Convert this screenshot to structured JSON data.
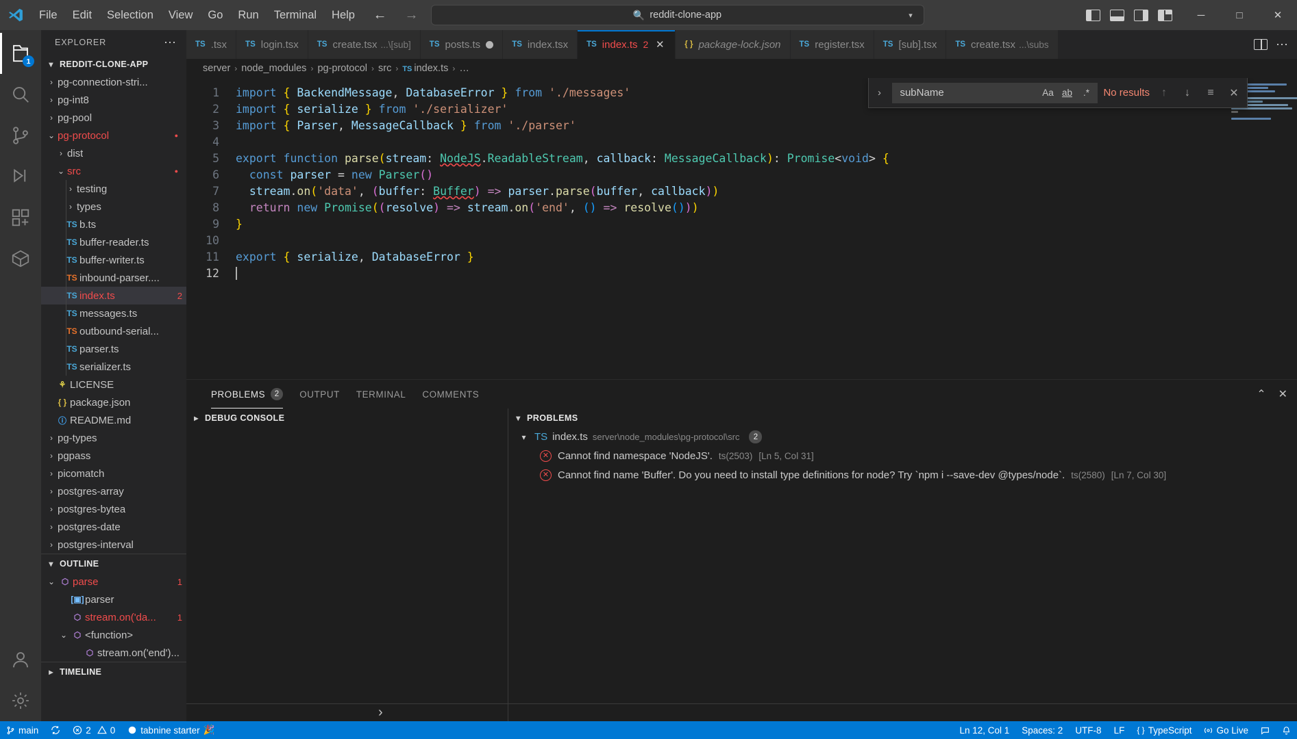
{
  "titlebar": {
    "menus": [
      "File",
      "Edit",
      "Selection",
      "View",
      "Go",
      "Run",
      "Terminal",
      "Help"
    ],
    "command_center_text": "reddit-clone-app",
    "search_icon": "search-icon",
    "back_icon": "arrow-left-icon",
    "forward_icon": "arrow-right-icon",
    "chevron": "⌄",
    "window_minimize": "─",
    "window_maximize": "□",
    "window_close": "✕"
  },
  "activitybar": {
    "items": [
      {
        "name": "explorer",
        "icon": "files-icon",
        "active": true,
        "badge": "1"
      },
      {
        "name": "search",
        "icon": "search-icon",
        "active": false,
        "badge": ""
      },
      {
        "name": "source-control",
        "icon": "source-control-icon",
        "active": false,
        "badge": ""
      },
      {
        "name": "run-and-debug",
        "icon": "debug-icon",
        "active": false,
        "badge": ""
      },
      {
        "name": "extensions",
        "icon": "extensions-icon",
        "active": false,
        "badge": ""
      },
      {
        "name": "remote-explorer",
        "icon": "remote-explorer-icon",
        "active": false,
        "badge": ""
      }
    ],
    "bottom": [
      {
        "name": "accounts",
        "icon": "account-icon"
      },
      {
        "name": "manage",
        "icon": "gear-icon"
      }
    ]
  },
  "sidebar": {
    "title": "EXPLORER",
    "more_actions": "⋯",
    "project": "REDDIT-CLONE-APP",
    "files": [
      {
        "label": "pg-connection-stri...",
        "type": "folder",
        "indent": 1,
        "expanded": false,
        "color": "",
        "count": ""
      },
      {
        "label": "pg-int8",
        "type": "folder",
        "indent": 1,
        "expanded": false,
        "color": "",
        "count": ""
      },
      {
        "label": "pg-pool",
        "type": "folder",
        "indent": 1,
        "expanded": false,
        "color": "",
        "count": ""
      },
      {
        "label": "pg-protocol",
        "type": "folder",
        "indent": 1,
        "expanded": true,
        "color": "error",
        "count": "dot"
      },
      {
        "label": "dist",
        "type": "folder",
        "indent": 2,
        "expanded": false,
        "color": "",
        "count": ""
      },
      {
        "label": "src",
        "type": "folder",
        "indent": 2,
        "expanded": true,
        "color": "error",
        "count": "dot"
      },
      {
        "label": "testing",
        "type": "folder",
        "indent": 3,
        "expanded": false,
        "color": "",
        "count": ""
      },
      {
        "label": "types",
        "type": "folder",
        "indent": 3,
        "expanded": false,
        "color": "",
        "count": ""
      },
      {
        "label": "b.ts",
        "type": "ts",
        "indent": 3,
        "expanded": false,
        "color": "",
        "count": ""
      },
      {
        "label": "buffer-reader.ts",
        "type": "ts",
        "indent": 3,
        "expanded": false,
        "color": "",
        "count": ""
      },
      {
        "label": "buffer-writer.ts",
        "type": "ts",
        "indent": 3,
        "expanded": false,
        "color": "",
        "count": ""
      },
      {
        "label": "inbound-parser....",
        "type": "ts-orange",
        "indent": 3,
        "expanded": false,
        "color": "",
        "count": ""
      },
      {
        "label": "index.ts",
        "type": "ts",
        "indent": 3,
        "expanded": false,
        "color": "error",
        "count": "2",
        "selected": true
      },
      {
        "label": "messages.ts",
        "type": "ts",
        "indent": 3,
        "expanded": false,
        "color": "",
        "count": ""
      },
      {
        "label": "outbound-serial...",
        "type": "ts-orange",
        "indent": 3,
        "expanded": false,
        "color": "",
        "count": ""
      },
      {
        "label": "parser.ts",
        "type": "ts",
        "indent": 3,
        "expanded": false,
        "color": "",
        "count": ""
      },
      {
        "label": "serializer.ts",
        "type": "ts",
        "indent": 3,
        "expanded": false,
        "color": "",
        "count": ""
      },
      {
        "label": "LICENSE",
        "type": "license",
        "indent": 2,
        "expanded": false,
        "color": "",
        "count": ""
      },
      {
        "label": "package.json",
        "type": "json",
        "indent": 2,
        "expanded": false,
        "color": "",
        "count": ""
      },
      {
        "label": "README.md",
        "type": "md",
        "indent": 2,
        "expanded": false,
        "color": "",
        "count": ""
      },
      {
        "label": "pg-types",
        "type": "folder",
        "indent": 1,
        "expanded": false,
        "color": "",
        "count": ""
      },
      {
        "label": "pgpass",
        "type": "folder",
        "indent": 1,
        "expanded": false,
        "color": "",
        "count": ""
      },
      {
        "label": "picomatch",
        "type": "folder",
        "indent": 1,
        "expanded": false,
        "color": "",
        "count": ""
      },
      {
        "label": "postgres-array",
        "type": "folder",
        "indent": 1,
        "expanded": false,
        "color": "",
        "count": ""
      },
      {
        "label": "postgres-bytea",
        "type": "folder",
        "indent": 1,
        "expanded": false,
        "color": "",
        "count": ""
      },
      {
        "label": "postgres-date",
        "type": "folder",
        "indent": 1,
        "expanded": false,
        "color": "",
        "count": ""
      },
      {
        "label": "postgres-interval",
        "type": "folder",
        "indent": 1,
        "expanded": false,
        "color": "",
        "count": ""
      }
    ],
    "outline": {
      "title": "OUTLINE",
      "items": [
        {
          "label": "parse",
          "symbol": "function",
          "indent": 1,
          "expanded": true,
          "count": "1",
          "error": true
        },
        {
          "label": "parser",
          "symbol": "variable",
          "indent": 2,
          "expanded": null,
          "count": "",
          "error": false
        },
        {
          "label": "stream.on('da...",
          "symbol": "function",
          "indent": 2,
          "expanded": null,
          "count": "1",
          "error": true
        },
        {
          "label": "<function>",
          "symbol": "function",
          "indent": 2,
          "expanded": true,
          "count": "",
          "error": false
        },
        {
          "label": "stream.on('end')...",
          "symbol": "function",
          "indent": 3,
          "expanded": null,
          "count": "",
          "error": false
        }
      ]
    },
    "timeline": {
      "title": "TIMELINE"
    }
  },
  "tabs": [
    {
      "label": ".tsx",
      "icon": "ts",
      "sub": "",
      "active": false,
      "modified": false,
      "errors": "",
      "preview": false,
      "partial": true
    },
    {
      "label": "login.tsx",
      "icon": "ts",
      "sub": "",
      "active": false,
      "modified": false,
      "errors": "",
      "preview": false
    },
    {
      "label": "create.tsx",
      "icon": "ts",
      "sub": "...\\[sub]",
      "active": false,
      "modified": false,
      "errors": "",
      "preview": false
    },
    {
      "label": "posts.ts",
      "icon": "ts",
      "sub": "",
      "active": false,
      "modified": true,
      "errors": "",
      "preview": false
    },
    {
      "label": "index.tsx",
      "icon": "ts",
      "sub": "",
      "active": false,
      "modified": false,
      "errors": "",
      "preview": false
    },
    {
      "label": "index.ts",
      "icon": "ts",
      "sub": "",
      "active": true,
      "modified": false,
      "errors": "2",
      "preview": false
    },
    {
      "label": "package-lock.json",
      "icon": "json",
      "sub": "",
      "active": false,
      "modified": false,
      "errors": "",
      "preview": true
    },
    {
      "label": "register.tsx",
      "icon": "ts",
      "sub": "",
      "active": false,
      "modified": false,
      "errors": "",
      "preview": false
    },
    {
      "label": "[sub].tsx",
      "icon": "ts",
      "sub": "",
      "active": false,
      "modified": false,
      "errors": "",
      "preview": false
    },
    {
      "label": "create.tsx",
      "icon": "ts",
      "sub": "...\\subs",
      "active": false,
      "modified": false,
      "errors": "",
      "preview": false
    }
  ],
  "breadcrumbs": [
    {
      "label": "server",
      "icon": ""
    },
    {
      "label": "node_modules",
      "icon": ""
    },
    {
      "label": "pg-protocol",
      "icon": ""
    },
    {
      "label": "src",
      "icon": ""
    },
    {
      "label": "index.ts",
      "icon": "ts"
    },
    {
      "label": "…",
      "icon": ""
    }
  ],
  "find": {
    "query": "subName",
    "placeholder": "Find",
    "result": "No results",
    "match_case": "Aa",
    "whole_word": "ab",
    "regex": ".*",
    "prev": "↑",
    "next": "↓",
    "find_in_selection": "≡",
    "close": "✕",
    "toggle_replace": "›"
  },
  "editor": {
    "language": "TypeScript",
    "lines": [
      {
        "n": "1",
        "text": "import { BackendMessage, DatabaseError } from './messages'"
      },
      {
        "n": "2",
        "text": "import { serialize } from './serializer'"
      },
      {
        "n": "3",
        "text": "import { Parser, MessageCallback } from './parser'"
      },
      {
        "n": "4",
        "text": ""
      },
      {
        "n": "5",
        "text": "export function parse(stream: NodeJS.ReadableStream, callback: MessageCallback): Promise<void> {"
      },
      {
        "n": "6",
        "text": "  const parser = new Parser()"
      },
      {
        "n": "7",
        "text": "  stream.on('data', (buffer: Buffer) => parser.parse(buffer, callback))"
      },
      {
        "n": "8",
        "text": "  return new Promise((resolve) => stream.on('end', () => resolve()))"
      },
      {
        "n": "9",
        "text": "}"
      },
      {
        "n": "10",
        "text": ""
      },
      {
        "n": "11",
        "text": "export { serialize, DatabaseError }"
      },
      {
        "n": "12",
        "text": ""
      }
    ]
  },
  "panel": {
    "tabs": [
      {
        "label": "PROBLEMS",
        "badge": "2",
        "active": true
      },
      {
        "label": "OUTPUT",
        "badge": "",
        "active": false
      },
      {
        "label": "TERMINAL",
        "badge": "",
        "active": false
      },
      {
        "label": "COMMENTS",
        "badge": "",
        "active": false
      }
    ],
    "actions": {
      "collapse": "⌃",
      "close": "✕"
    },
    "debug_console": {
      "title": "DEBUG CONSOLE",
      "chevron": "›"
    },
    "problems": {
      "title": "PROBLEMS",
      "file": {
        "name": "index.ts",
        "path": "server\\node_modules\\pg-protocol\\src",
        "count": "2",
        "icon": "ts"
      },
      "items": [
        {
          "message": "Cannot find namespace 'NodeJS'.",
          "code": "ts(2503)",
          "location": "[Ln 5, Col 31]",
          "severity": "error"
        },
        {
          "message": "Cannot find name 'Buffer'. Do you need to install type definitions for node? Try `npm i --save-dev @types/node`.",
          "code": "ts(2580)",
          "location": "[Ln 7, Col 30]",
          "severity": "error"
        }
      ]
    }
  },
  "statusbar": {
    "branch": "main",
    "branch_icon": "source-control-icon",
    "sync_icon": "sync-icon",
    "errors": "2",
    "warnings": "0",
    "error_icon": "error-icon",
    "warning_icon": "warning-icon",
    "tabnine": "tabnine starter",
    "tabnine_icon": "tabnine-icon",
    "tabnine_emoji": "🎉",
    "cursor_position": "Ln 12, Col 1",
    "spaces": "Spaces: 2",
    "encoding": "UTF-8",
    "eol": "LF",
    "language": "TypeScript",
    "language_icon": "braces-icon",
    "golive": "Go Live",
    "golive_icon": "broadcast-icon",
    "bell_icon": "bell-icon",
    "feedback_icon": "feedback-icon"
  },
  "colors": {
    "accent": "#0078d4",
    "error": "#f14c4c",
    "titlebar_bg": "#3c3c3c",
    "sidebar_bg": "#252526",
    "editor_bg": "#1e1e1e",
    "activitybar_bg": "#333333"
  }
}
